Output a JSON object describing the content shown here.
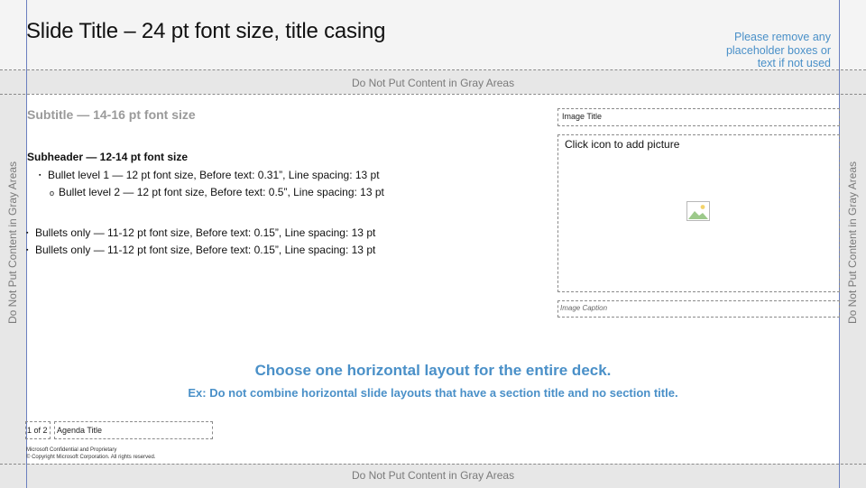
{
  "slide": {
    "title": "Slide Title – 24 pt font size, title casing",
    "note_line1": "Please remove any",
    "note_line2": "placeholder boxes or",
    "note_line3": "text if not used",
    "gray_label": "Do Not Put Content in Gray Areas",
    "subtitle": "Subtitle — 14-16 pt font size",
    "subheader": "Subheader — 12-14 pt font size",
    "bullets": [
      {
        "marker": "▪",
        "text": "Bullet level 1 — 12 pt font size, Before text: 0.31”, Line spacing: 13 pt"
      },
      {
        "marker": "o",
        "text": "Bullet level 2 — 12 pt font size, Before text: 0.5”, Line spacing: 13 pt"
      },
      {
        "marker": "▪",
        "text": "Bullets only — 11-12 pt font size, Before text: 0.15”, Line spacing: 13 pt"
      },
      {
        "marker": "▪",
        "text": "Bullets only — 11-12 pt font size, Before text: 0.15”, Line spacing: 13 pt"
      }
    ],
    "image_title": "Image Title",
    "picture_prompt": "Click icon to add picture",
    "picture_icon": "picture-icon",
    "image_caption": "Image Caption",
    "layout_message": "Choose one horizontal layout for the entire deck.",
    "layout_example": "Ex: Do not combine horizontal slide layouts that have a section title and no section title.",
    "page_number": "1 of 2",
    "agenda_title": "Agenda Title",
    "confidential": "Microsoft Confidential and Proprietary",
    "copyright": "© Copyright Microsoft Corporation. All rights reserved."
  },
  "colors": {
    "accent": "#4a90c8",
    "gray_area": "#e7e7e7",
    "subtitle": "#9a9a9a"
  }
}
